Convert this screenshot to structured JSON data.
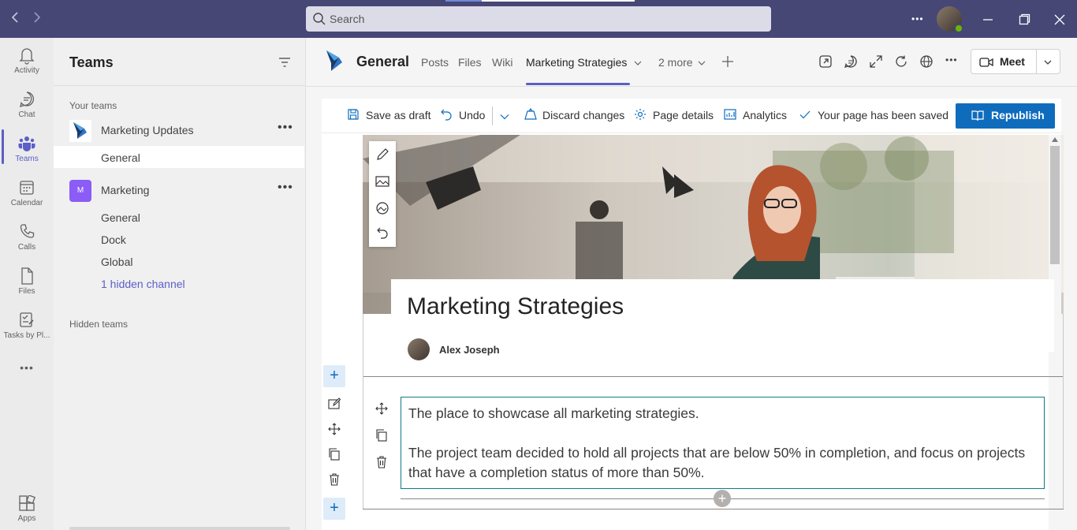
{
  "titlebar": {
    "search_placeholder": "Search",
    "more": "•••"
  },
  "rail": {
    "items": [
      {
        "label": "Activity",
        "icon": "bell-icon"
      },
      {
        "label": "Chat",
        "icon": "chat-icon"
      },
      {
        "label": "Teams",
        "icon": "teams-icon"
      },
      {
        "label": "Calendar",
        "icon": "calendar-icon"
      },
      {
        "label": "Calls",
        "icon": "phone-icon"
      },
      {
        "label": "Files",
        "icon": "file-icon"
      },
      {
        "label": "Tasks by Pl...",
        "icon": "tasks-icon"
      },
      {
        "label": "Apps",
        "icon": "apps-icon"
      }
    ],
    "more": "•••"
  },
  "teams": {
    "title": "Teams",
    "your_teams": "Your teams",
    "hidden_teams": "Hidden teams",
    "more": "•••",
    "team1": {
      "name": "Marketing Updates",
      "channels": [
        "General"
      ]
    },
    "team2": {
      "name": "Marketing",
      "initial": "M",
      "channels": [
        "General",
        "Dock",
        "Global"
      ],
      "hidden_link": "1 hidden channel"
    }
  },
  "header": {
    "title": "General",
    "tabs": [
      "Posts",
      "Files",
      "Wiki",
      "Marketing Strategies",
      "2 more"
    ],
    "meet": "Meet",
    "more": "•••"
  },
  "toolbar": {
    "save_draft": "Save as draft",
    "undo": "Undo",
    "discard": "Discard changes",
    "page_details": "Page details",
    "analytics": "Analytics",
    "saved_status": "Your page has been saved",
    "republish": "Republish"
  },
  "page": {
    "title": "Marketing Strategies",
    "author": "Alex Joseph",
    "para1": "The place to showcase all marketing strategies.",
    "para2": "The project team decided to hold all projects that are below 50% in completion, and focus on projects that have a completion status of more than 50%."
  },
  "colors": {
    "titlebar": "#464775",
    "accent": "#5b5fc7",
    "primary_button": "#0f6cbd"
  }
}
